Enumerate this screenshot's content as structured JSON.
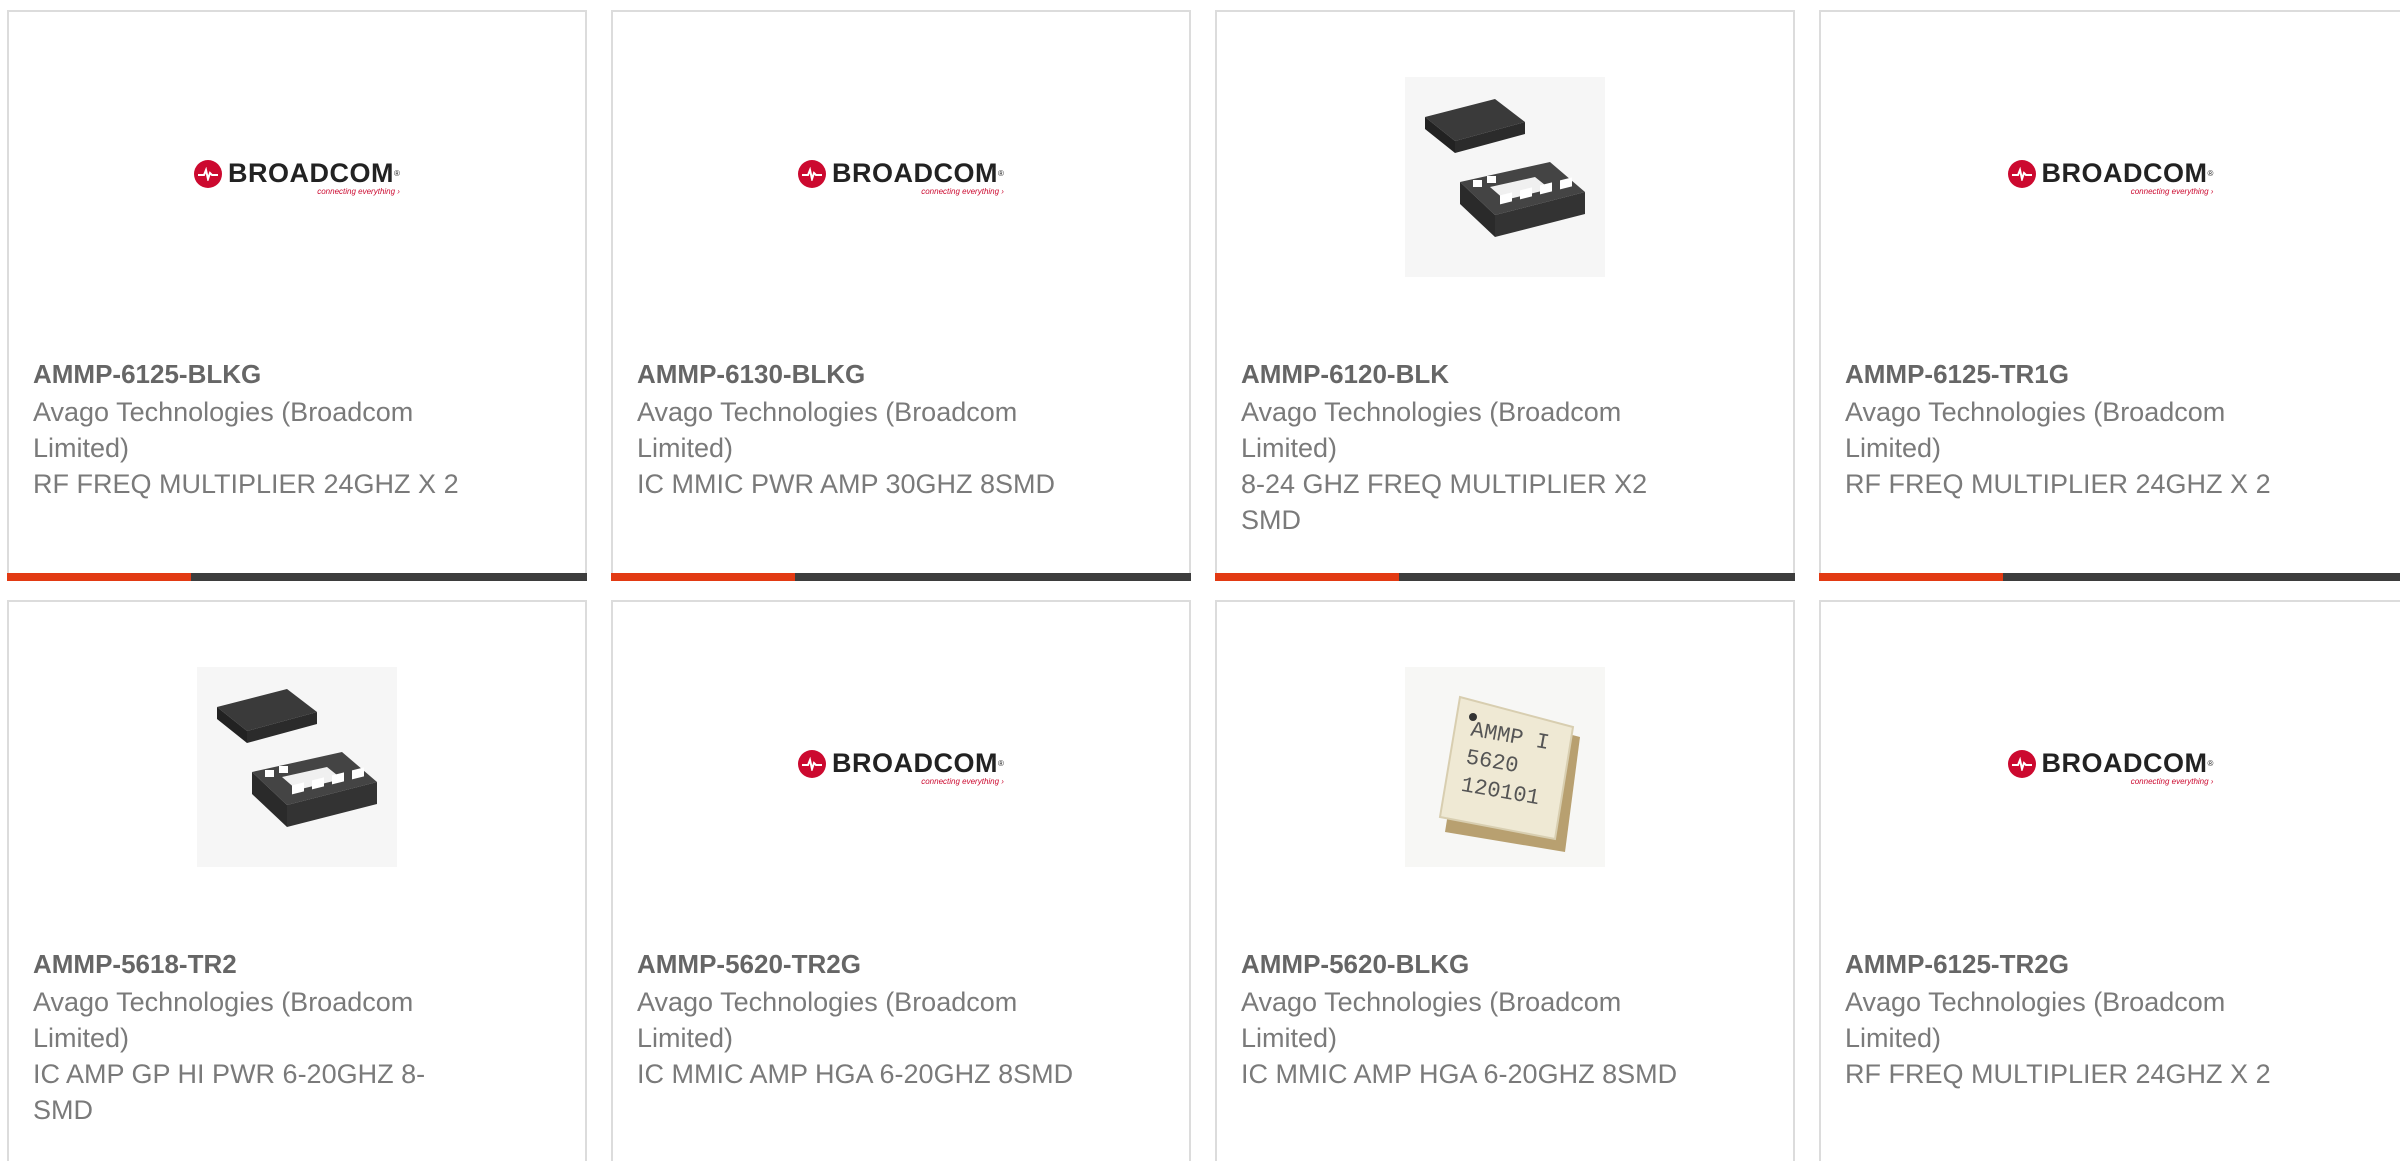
{
  "products": [
    {
      "part_number": "AMMP-6125-BLKG",
      "manufacturer": "Avago Technologies (Broadcom Limited)",
      "description": "RF FREQ MULTIPLIER 24GHZ X 2",
      "image": "broadcom-logo"
    },
    {
      "part_number": "AMMP-6130-BLKG",
      "manufacturer": "Avago Technologies (Broadcom Limited)",
      "description": "IC MMIC PWR AMP 30GHZ 8SMD",
      "image": "broadcom-logo"
    },
    {
      "part_number": "AMMP-6120-BLK",
      "manufacturer": "Avago Technologies (Broadcom Limited)",
      "description": "8-24 GHZ FREQ MULTIPLIER X2 SMD",
      "image": "qfn-package"
    },
    {
      "part_number": "AMMP-6125-TR1G",
      "manufacturer": "Avago Technologies (Broadcom Limited)",
      "description": "RF FREQ MULTIPLIER 24GHZ X 2",
      "image": "broadcom-logo"
    },
    {
      "part_number": "AMMP-5618-TR2",
      "manufacturer": "Avago Technologies (Broadcom Limited)",
      "description": "IC AMP GP HI PWR 6-20GHZ 8-SMD",
      "image": "qfn-package"
    },
    {
      "part_number": "AMMP-5620-TR2G",
      "manufacturer": "Avago Technologies (Broadcom Limited)",
      "description": "IC MMIC AMP HGA 6-20GHZ 8SMD",
      "image": "broadcom-logo"
    },
    {
      "part_number": "AMMP-5620-BLKG",
      "manufacturer": "Avago Technologies (Broadcom Limited)",
      "description": "IC MMIC AMP HGA 6-20GHZ 8SMD",
      "image": "ceramic-package"
    },
    {
      "part_number": "AMMP-6125-TR2G",
      "manufacturer": "Avago Technologies (Broadcom Limited)",
      "description": "RF FREQ MULTIPLIER 24GHZ X 2",
      "image": "broadcom-logo"
    }
  ],
  "logo": {
    "wordmark": "BROADCOM",
    "registered": "®",
    "tagline": "connecting everything ›"
  },
  "ceramic_marking": {
    "line1": "AMMP I",
    "line2": "5620",
    "line3": "120101"
  },
  "colors": {
    "accent": "#e23a13",
    "bar": "#3d3d3d",
    "brand_red": "#cc092f"
  }
}
